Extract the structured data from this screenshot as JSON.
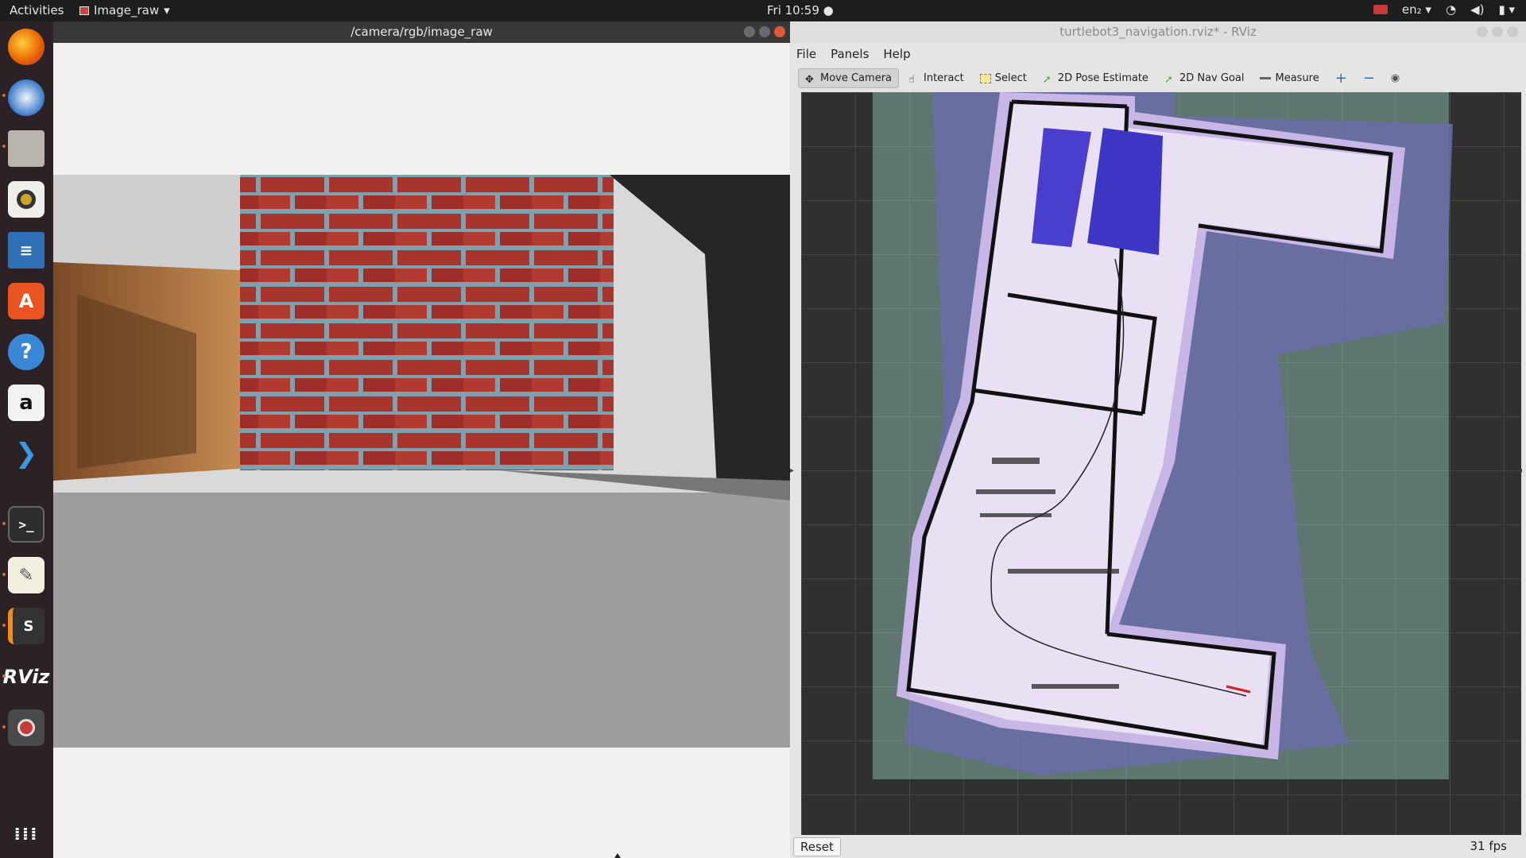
{
  "topbar": {
    "activities": "Activities",
    "app_name": "Image_raw",
    "clock": "Fri 10:59",
    "lang": "en₂"
  },
  "dock": {
    "items": [
      "firefox-icon",
      "thunderbird-icon",
      "files-icon",
      "rhythmbox-icon",
      "writer-icon",
      "software-icon",
      "help-icon",
      "amazon-icon",
      "vscode-icon",
      "terminal-icon",
      "text-editor-icon",
      "sublime-icon",
      "rviz-icon",
      "recorder-icon",
      "show-apps-icon"
    ]
  },
  "image_window": {
    "title": "/camera/rgb/image_raw"
  },
  "rviz_window": {
    "title": "turtlebot3_navigation.rviz* - RViz",
    "menu": [
      "File",
      "Panels",
      "Help"
    ],
    "tools": [
      "Move Camera",
      "Interact",
      "Select",
      "2D Pose Estimate",
      "2D Nav Goal",
      "Measure"
    ],
    "reset_label": "Reset",
    "fps": "31 fps"
  },
  "colors": {
    "topbar": "#1d1d1d",
    "dock": "#2c2226",
    "panel": "#e7e5e3",
    "costmap_inflate": "#c7b6e6",
    "lethal": "#2a2aa8"
  }
}
